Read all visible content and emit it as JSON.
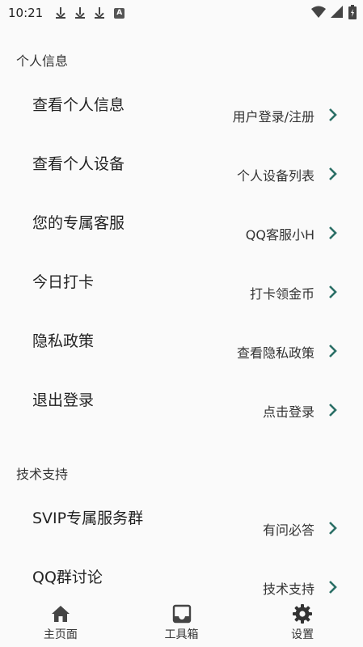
{
  "status_bar": {
    "time": "10:21",
    "left_icons": [
      "download-icon",
      "download-icon",
      "download-icon",
      "a-icon"
    ],
    "a_label": "A",
    "right_icons": [
      "wifi-icon",
      "signal-icon",
      "battery-icon"
    ]
  },
  "accent_color": "#2b6f66",
  "sections": [
    {
      "header": "个人信息",
      "rows": [
        {
          "title": "查看个人信息",
          "value": "用户登录/注册"
        },
        {
          "title": "查看个人设备",
          "value": "个人设备列表"
        },
        {
          "title": "您的专属客服",
          "value": "QQ客服小H"
        },
        {
          "title": "今日打卡",
          "value": "打卡领金币"
        },
        {
          "title": "隐私政策",
          "value": "查看隐私政策"
        },
        {
          "title": "退出登录",
          "value": "点击登录"
        }
      ]
    },
    {
      "header": "技术支持",
      "rows": [
        {
          "title": "SVIP专属服务群",
          "value": "有问必答"
        },
        {
          "title": "QQ群讨论",
          "value": "技术支持"
        }
      ]
    }
  ],
  "bottom_nav": [
    {
      "label": "主页面",
      "icon": "home-icon"
    },
    {
      "label": "工具箱",
      "icon": "inbox-icon"
    },
    {
      "label": "设置",
      "icon": "gear-icon"
    }
  ]
}
